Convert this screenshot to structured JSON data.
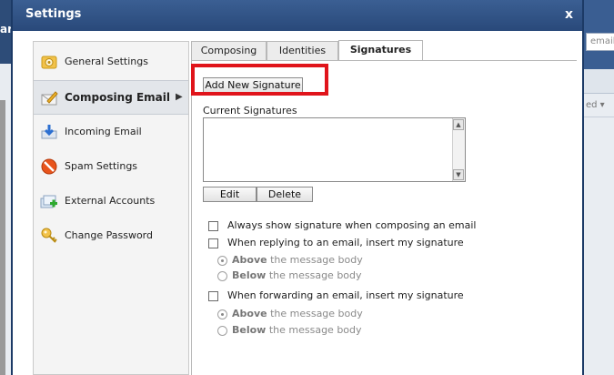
{
  "background": {
    "left_label": "ar",
    "search_placeholder": "email f",
    "sort_label": "ed ▾"
  },
  "dialog": {
    "title": "Settings",
    "close_label": "x"
  },
  "sidebar": {
    "items": [
      {
        "label": "General Settings",
        "icon": "gear-folder-icon"
      },
      {
        "label": "Composing Email",
        "icon": "compose-envelope-icon",
        "active": true,
        "arrow": "▶"
      },
      {
        "label": "Incoming Email",
        "icon": "download-arrow-icon"
      },
      {
        "label": "Spam Settings",
        "icon": "no-entry-icon"
      },
      {
        "label": "External Accounts",
        "icon": "add-accounts-icon"
      },
      {
        "label": "Change Password",
        "icon": "key-icon"
      }
    ]
  },
  "tabs": [
    {
      "label": "Composing"
    },
    {
      "label": "Identities"
    },
    {
      "label": "Signatures",
      "selected": true
    }
  ],
  "signatures": {
    "add_button": "Add New Signature",
    "current_label": "Current Signatures",
    "edit_button": "Edit",
    "delete_button": "Delete",
    "always_show": "Always show signature when composing an email",
    "replying": "When replying to an email, insert my signature",
    "forwarding": "When forwarding an email, insert my signature",
    "above_bold": "Above",
    "above_rest": " the message body",
    "below_bold": "Below",
    "below_rest": " the message body"
  },
  "colors": {
    "titlebar": "#2f5285",
    "highlight": "#e0141b"
  }
}
